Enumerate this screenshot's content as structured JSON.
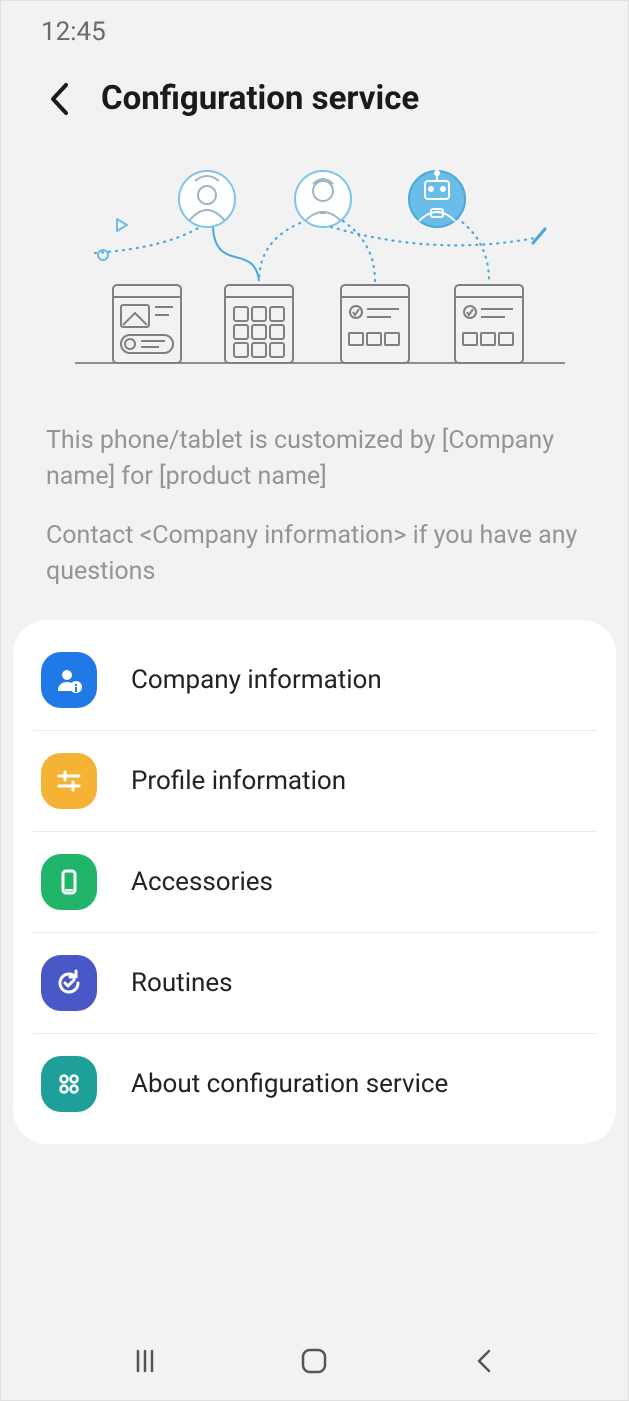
{
  "status": {
    "time": "12:45"
  },
  "header": {
    "title": "Configuration service"
  },
  "description": {
    "line1": "This phone/tablet is customized by [Company name] for [product name]",
    "line2": "Contact <Company information> if you have any questions"
  },
  "menu": {
    "items": [
      {
        "label": "Company information",
        "icon": "person-info-icon",
        "color": "#1f79e6"
      },
      {
        "label": "Profile information",
        "icon": "sliders-icon",
        "color": "#f5b335"
      },
      {
        "label": "Accessories",
        "icon": "phone-shape-icon",
        "color": "#21b569"
      },
      {
        "label": "Routines",
        "icon": "refresh-check-icon",
        "color": "#4a57c6"
      },
      {
        "label": "About configuration service",
        "icon": "four-dots-icon",
        "color": "#1f9f99"
      }
    ]
  }
}
